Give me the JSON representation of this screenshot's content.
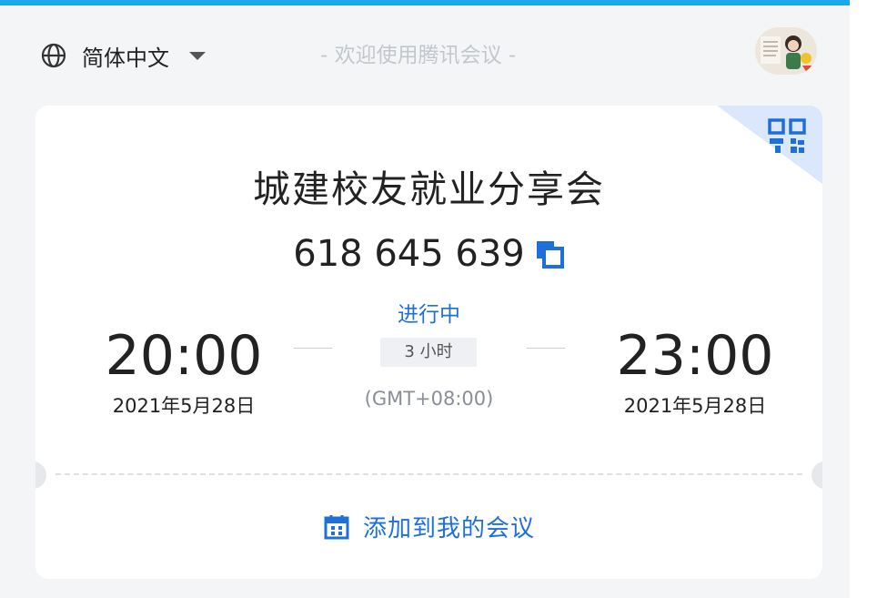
{
  "header": {
    "language_label": "简体中文",
    "welcome_text": "- 欢迎使用腾讯会议 -"
  },
  "meeting": {
    "title": "城建校友就业分享会",
    "id": "618 645 639",
    "status": "进行中",
    "start_time": "20:00",
    "start_date": "2021年5月28日",
    "end_time": "23:00",
    "end_date": "2021年5月28日",
    "duration": "3 小时",
    "timezone": "(GMT+08:00)"
  },
  "actions": {
    "add_to_my_meetings": "添加到我的会议"
  },
  "icons": {
    "language": "globe-icon",
    "dropdown": "caret-down-icon",
    "qr": "qr-code-icon",
    "copy": "copy-icon",
    "calendar": "calendar-icon"
  },
  "colors": {
    "accent": "#1e6fd9",
    "top_bar": "#1aa8e8",
    "background": "#f4f5f7",
    "card": "#ffffff"
  }
}
